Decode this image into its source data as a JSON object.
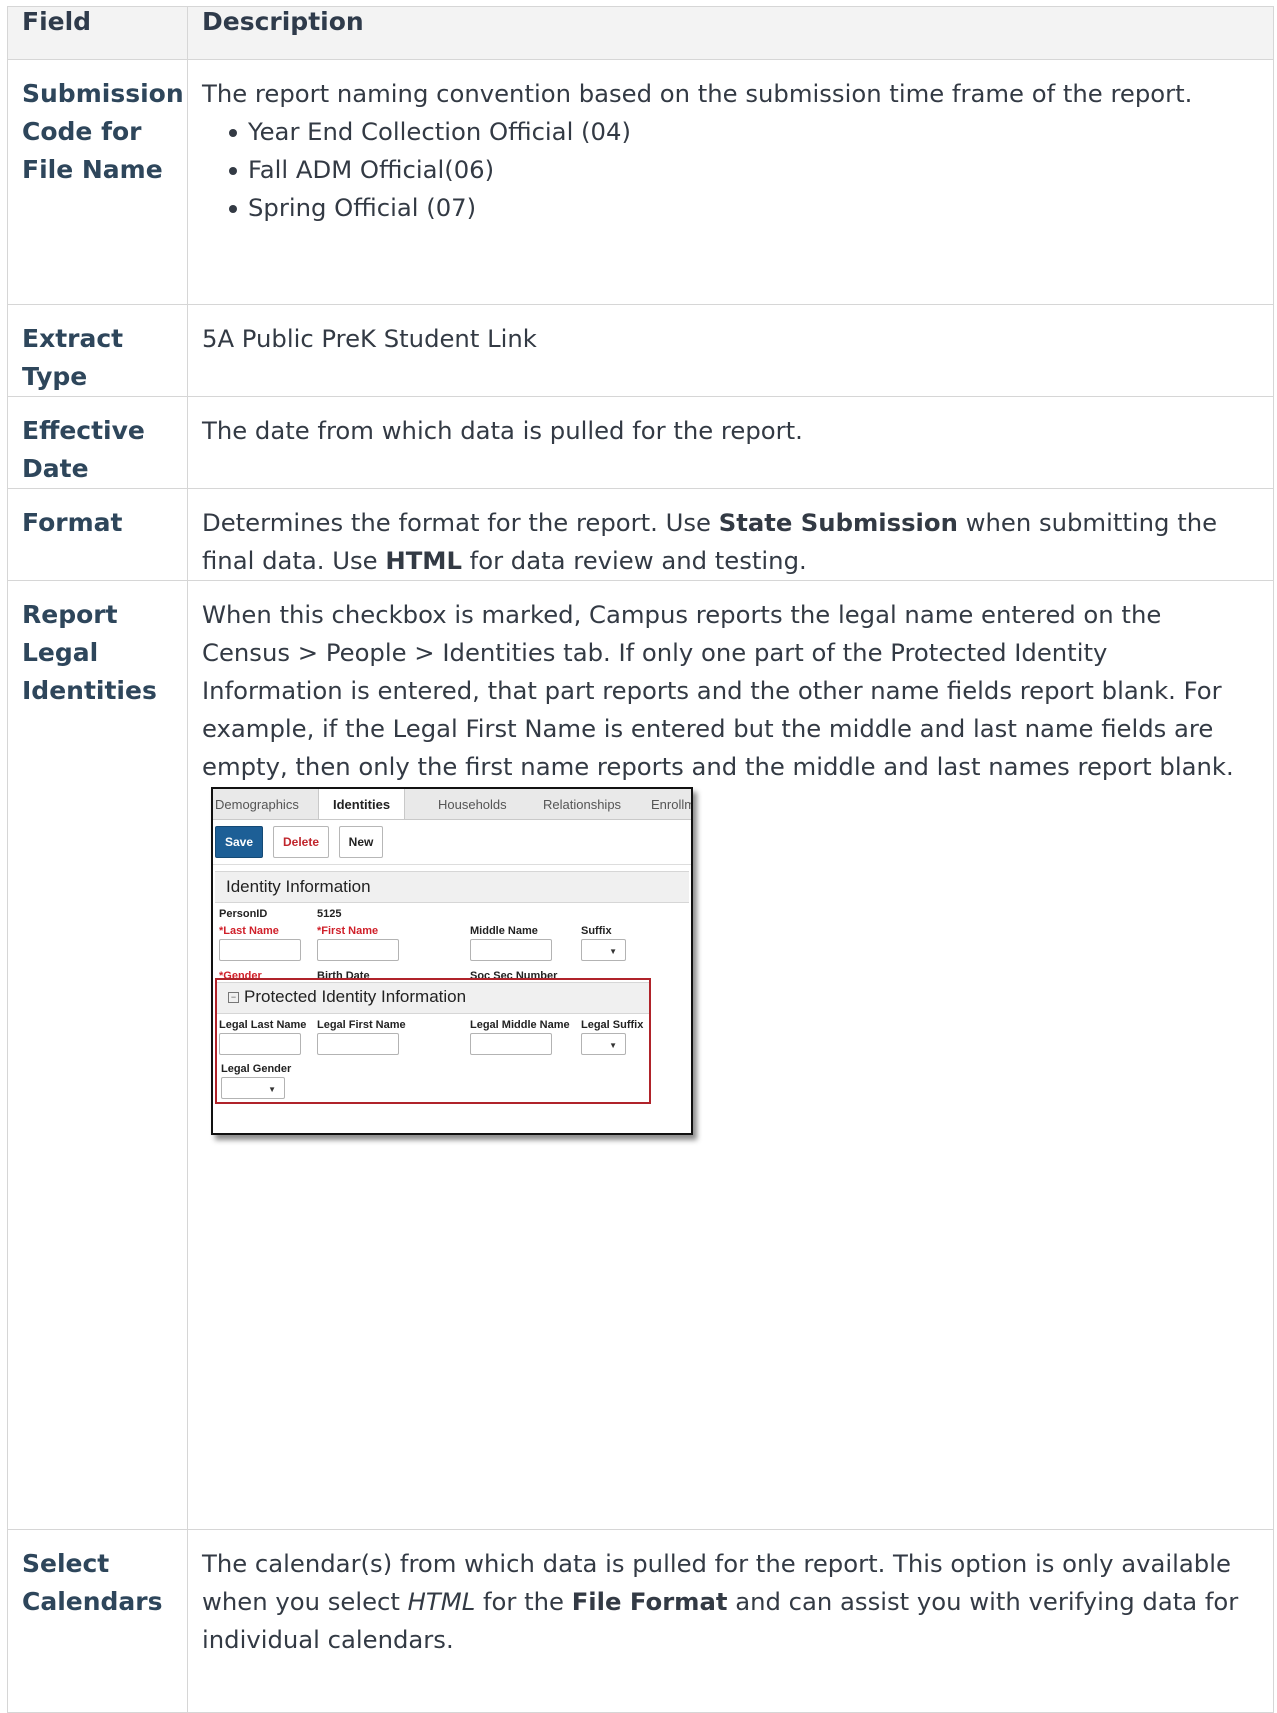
{
  "table": {
    "headers": {
      "field": "Field",
      "description": "Description"
    },
    "rows": {
      "submission": {
        "field": "Submission Code for File Name",
        "desc": "The report naming convention based on the submission time frame of the report.",
        "bullets": [
          "Year End Collection Official (04)",
          "Fall ADM Official(06)",
          "Spring Official (07)"
        ]
      },
      "extract": {
        "field": "Extract Type",
        "desc": "5A Public PreK Student Link"
      },
      "effective": {
        "field": "Effective Date",
        "desc": "The date from which data is pulled for the report."
      },
      "format": {
        "field": "Format",
        "desc_1": "Determines the format for the report. Use ",
        "bold_1": "State Submission",
        "desc_2": " when submitting the final data. Use ",
        "bold_2": "HTML",
        "desc_3": " for data review and testing."
      },
      "legal": {
        "field": "Report Legal Identities",
        "desc": "When this checkbox is marked, Campus reports the legal name entered on the Census > People > Identities tab. If only one part of the Protected Identity Information is entered, that part reports and the other name fields report blank. For example, if the Legal First Name is entered but the middle and last name fields are empty, then only the first name reports and the middle and last names report blank."
      },
      "calendars": {
        "field": "Select Calendars",
        "desc_1": "The calendar(s) from which data is pulled for the report. This option is only available when you select ",
        "italic_1": "HTML",
        "desc_2": " for the ",
        "bold_1": "File Format",
        "desc_3": " and can assist you with verifying data for individual calendars."
      }
    }
  },
  "screenshot": {
    "tabs": [
      "Demographics",
      "Identities",
      "Households",
      "Relationships",
      "Enrollme"
    ],
    "buttons": {
      "save": "Save",
      "delete": "Delete",
      "new": "New"
    },
    "identity_section": "Identity Information",
    "person_id_label": "PersonID",
    "person_id_value": "5125",
    "last_name": "*Last Name",
    "first_name": "*First Name",
    "middle_name": "Middle Name",
    "suffix": "Suffix",
    "gender": "*Gender",
    "birth_date": "Birth Date",
    "ssn": "Soc Sec Number",
    "protected_section": "Protected Identity Information",
    "legal_last": "Legal Last Name",
    "legal_first": "Legal First Name",
    "legal_middle": "Legal Middle Name",
    "legal_suffix": "Legal Suffix",
    "legal_gender": "Legal Gender",
    "colors": {
      "required": "#d0202a",
      "save_button": "#1d5f96",
      "highlight_border": "#b0232a"
    },
    "icons": {
      "dropdown": "chevron-down-icon",
      "calendar": "calendar-icon",
      "collapse": "collapse-icon"
    }
  }
}
